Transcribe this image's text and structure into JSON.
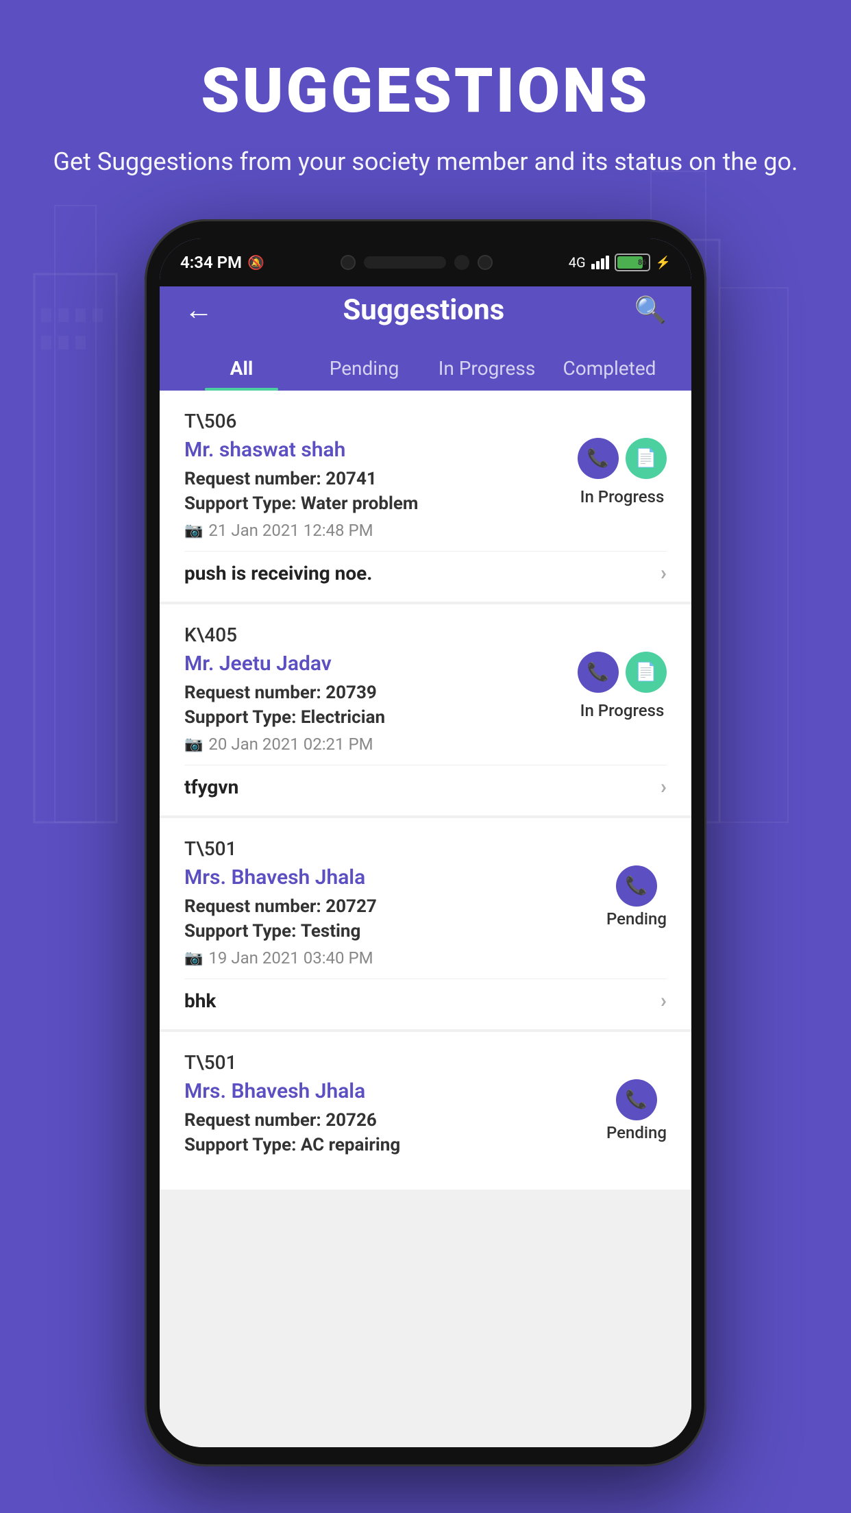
{
  "background": {
    "title": "SUGGESTIONS",
    "subtitle": "Get Suggestions from your society member\nand its status on the go."
  },
  "phone": {
    "status_bar": {
      "time": "4:34 PM",
      "battery_percent": "86",
      "network": "4G"
    },
    "header": {
      "title": "Suggestions",
      "back_label": "←",
      "search_label": "🔍"
    },
    "tabs": [
      {
        "id": "all",
        "label": "All",
        "active": true
      },
      {
        "id": "pending",
        "label": "Pending",
        "active": false
      },
      {
        "id": "in-progress",
        "label": "In Progress",
        "active": false
      },
      {
        "id": "completed",
        "label": "Completed",
        "active": false
      }
    ],
    "suggestions": [
      {
        "unit": "T\\506",
        "name": "Mr. shaswat  shah",
        "request_number": "20741",
        "support_type": "Water problem",
        "date": "21 Jan 2021 12:48 PM",
        "description": "push is receiving noe.",
        "status": "In Progress",
        "has_doc_icon": true
      },
      {
        "unit": "K\\405",
        "name": "Mr. Jeetu  Jadav",
        "request_number": "20739",
        "support_type": "Electrician",
        "date": "20 Jan 2021 02:21 PM",
        "description": "tfygvn",
        "status": "In Progress",
        "has_doc_icon": true
      },
      {
        "unit": "T\\501",
        "name": "Mrs. Bhavesh  Jhala",
        "request_number": "20727",
        "support_type": "Testing",
        "date": "19 Jan 2021 03:40 PM",
        "description": "bhk",
        "status": "Pending",
        "has_doc_icon": false
      },
      {
        "unit": "T\\501",
        "name": "Mrs. Bhavesh  Jhala",
        "request_number": "20726",
        "support_type": "AC repairing",
        "date": "",
        "description": "",
        "status": "Pending",
        "has_doc_icon": false
      }
    ],
    "labels": {
      "request_prefix": "Request number:",
      "support_prefix": "Support Type:",
      "in_progress": "In Progress",
      "pending": "Pending"
    }
  }
}
